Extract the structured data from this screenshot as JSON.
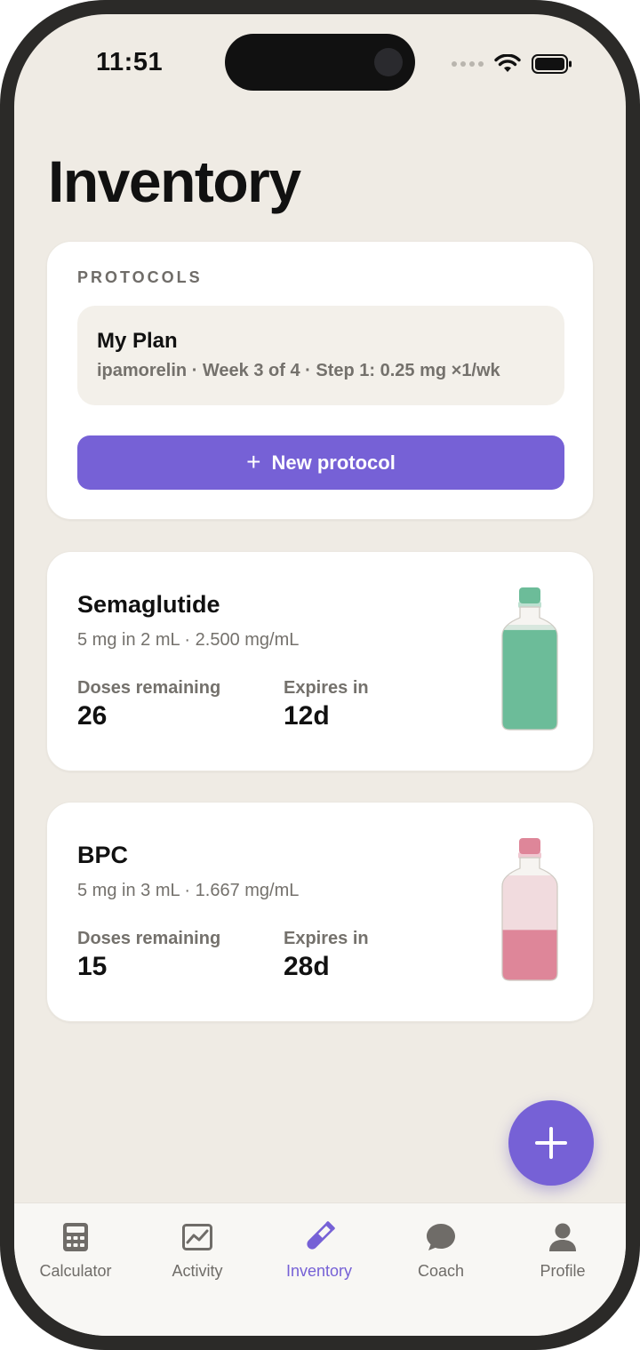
{
  "status": {
    "time": "11:51"
  },
  "page_title": "Inventory",
  "protocols": {
    "section_label": "PROTOCOLS",
    "plan": {
      "name": "My Plan",
      "detail": "ipamorelin · Week 3 of 4 · Step 1: 0.25 mg ×1/wk"
    },
    "new_button_label": "New protocol"
  },
  "vials": [
    {
      "name": "Semaglutide",
      "concentration": "5 mg in 2 mL · 2.500 mg/mL",
      "doses_label": "Doses remaining",
      "doses_value": "26",
      "expires_label": "Expires in",
      "expires_value": "12d",
      "color": "#6cbc99",
      "fill_fraction": 0.95
    },
    {
      "name": "BPC",
      "concentration": "5 mg in 3 mL · 1.667 mg/mL",
      "doses_label": "Doses remaining",
      "doses_value": "15",
      "expires_label": "Expires in",
      "expires_value": "28d",
      "color": "#de8699",
      "fill_fraction": 0.48
    }
  ],
  "tabs": [
    {
      "label": "Calculator",
      "icon": "calculator-icon"
    },
    {
      "label": "Activity",
      "icon": "chart-icon"
    },
    {
      "label": "Inventory",
      "icon": "test-tube-icon",
      "active": true
    },
    {
      "label": "Coach",
      "icon": "chat-bubble-icon"
    },
    {
      "label": "Profile",
      "icon": "person-icon"
    }
  ],
  "colors": {
    "accent": "#7661d6",
    "background": "#efebe4"
  }
}
